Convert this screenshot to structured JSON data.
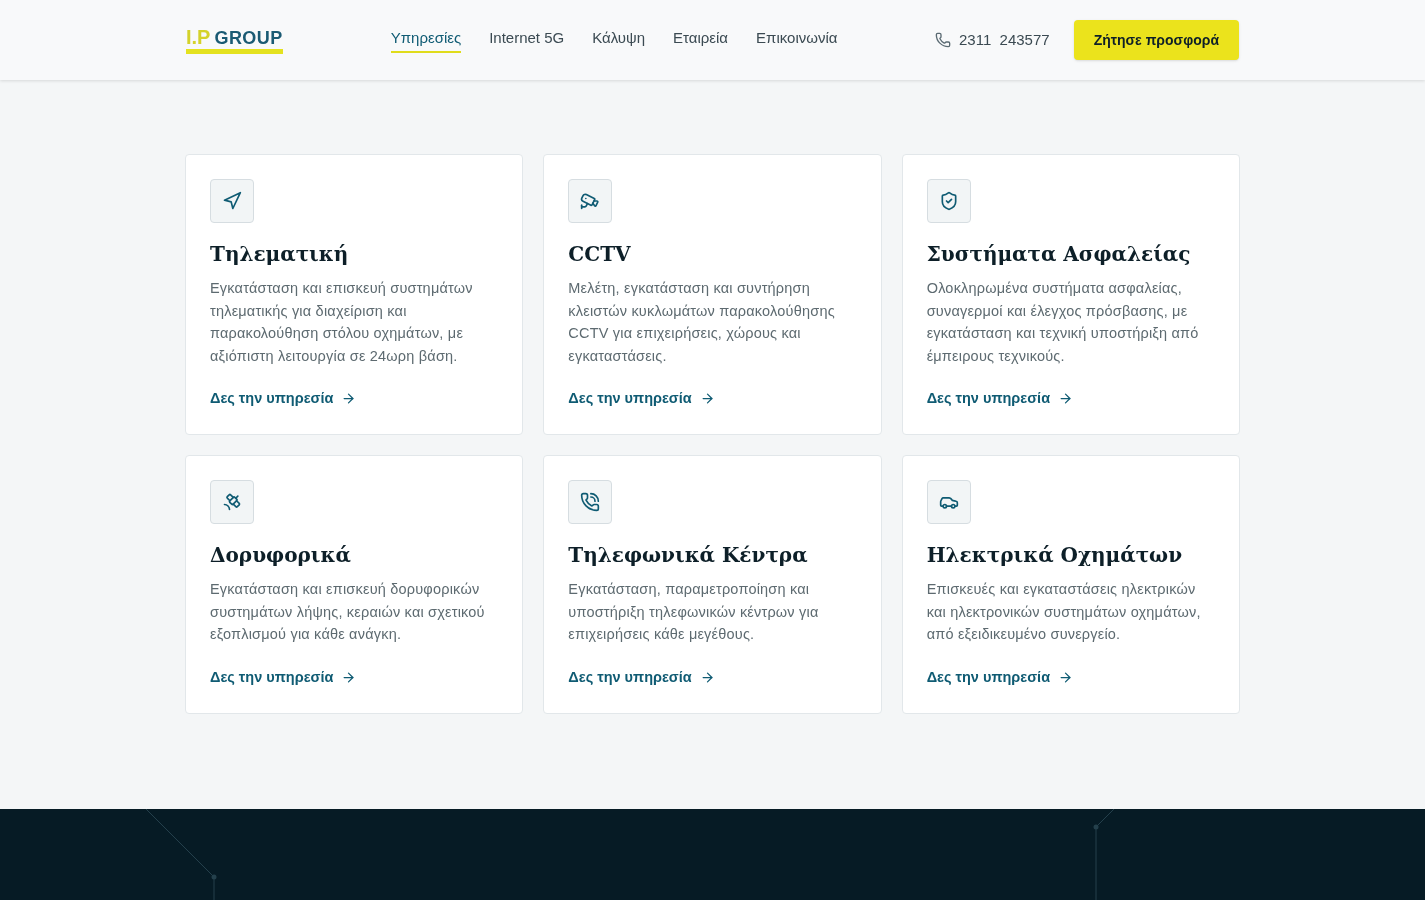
{
  "header": {
    "logo": {
      "mark": "I.P",
      "name": "GROUP"
    },
    "nav": [
      {
        "label": "Υπηρεσίες",
        "selected": true
      },
      {
        "label": "Internet 5G",
        "selected": false
      },
      {
        "label": "Κάλυψη",
        "selected": false
      },
      {
        "label": "Εταιρεία",
        "selected": false
      },
      {
        "label": "Επικοινωνία",
        "selected": false
      }
    ],
    "phone": "2311  243577",
    "cta": "Ζήτησε προσφορά"
  },
  "services": [
    {
      "kind": "navigation",
      "title": "Τηλεματική",
      "text": "Εγκατάσταση και επισκευή συστημάτων τηλεματικής για διαχείριση και παρακολούθηση στόλου οχημάτων, με αξιόπιστη λειτουργία σε 24ωρη βάση.",
      "link": "Δες την υπηρεσία"
    },
    {
      "kind": "cctv",
      "title": "CCTV",
      "text": "Μελέτη, εγκατάσταση και συντήρηση κλειστών κυκλωμάτων παρακολούθησης CCTV για επιχειρήσεις, χώρους και εγκαταστάσεις.",
      "link": "Δες την υπηρεσία"
    },
    {
      "kind": "shield",
      "title": "Συστήματα Ασφαλείας",
      "text": "Ολοκληρωμένα συστήματα ασφαλείας, συναγερμοί και έλεγχος πρόσβασης, με εγκατάσταση και τεχνική υποστήριξη από έμπειρους τεχνικούς.",
      "link": "Δες την υπηρεσία"
    },
    {
      "kind": "satellite",
      "title": "Δορυφορικά",
      "text": "Εγκατάσταση και επισκευή δορυφορικών συστημάτων λήψης, κεραιών και σχετικού εξοπλισμού για κάθε ανάγκη.",
      "link": "Δες την υπηρεσία"
    },
    {
      "kind": "phone",
      "title": "Τηλεφωνικά Κέντρα",
      "text": "Εγκατάσταση, παραμετροποίηση και υποστήριξη τηλεφωνικών κέντρων για επιχειρήσεις κάθε μεγέθους.",
      "link": "Δες την υπηρεσία"
    },
    {
      "kind": "car",
      "title": "Ηλεκτρικά Οχημάτων",
      "text": "Επισκευές και εγκαταστάσεις ηλεκτρικών και ηλεκτρονικών συστημάτων οχημάτων, από εξειδικευμένο συνεργείο.",
      "link": "Δες την υπηρεσία"
    }
  ]
}
